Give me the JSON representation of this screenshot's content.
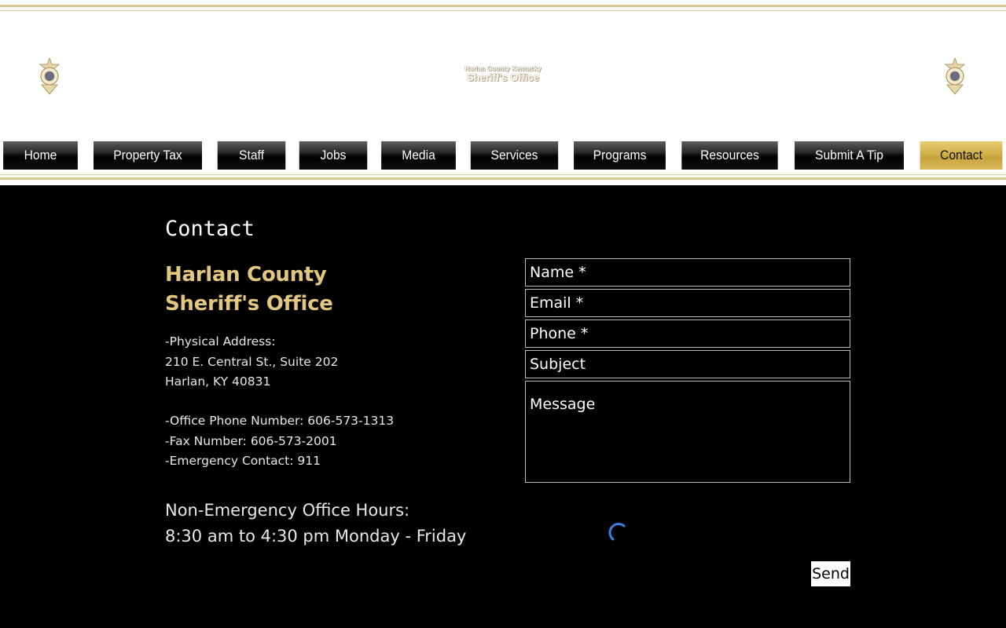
{
  "header": {
    "title_line1": "Harlan County Kentucky",
    "title_line2": "Sheriff's Office",
    "left_logo": "sheriff-badge-icon",
    "right_logo": "sheriff-badge-icon"
  },
  "nav": {
    "items": [
      {
        "label": "Home"
      },
      {
        "label": "Property Tax"
      },
      {
        "label": "Staff"
      },
      {
        "label": "Jobs"
      },
      {
        "label": "Media"
      },
      {
        "label": "Services"
      },
      {
        "label": "Programs"
      },
      {
        "label": "Resources"
      },
      {
        "label": "Submit A Tip"
      },
      {
        "label": "Contact"
      }
    ],
    "active": "Contact"
  },
  "main": {
    "page_title": "Contact",
    "org_line1": "Harlan County",
    "org_line2": "Sheriff's Office",
    "address_label": "-Physical Address:",
    "address_line1": "210 E. Central St., Suite 202",
    "address_line2": "Harlan, KY 40831",
    "phone": "-Office Phone Number: 606-573-1313",
    "fax": "-Fax Number: 606-573-2001",
    "emergency": "-Emergency Contact: 911",
    "hours_title": "Non-Emergency Office Hours:",
    "hours_value": "8:30 am to 4:30 pm Monday - Friday"
  },
  "form": {
    "name_placeholder": "Name *",
    "email_placeholder": "Email *",
    "phone_placeholder": "Phone *",
    "subject_placeholder": "Subject",
    "message_placeholder": "Message",
    "send_label": "Send"
  },
  "colors": {
    "accent_gold": "#e3c77f",
    "nav_active": "#d2b04a",
    "spinner": "#3b7de0"
  }
}
